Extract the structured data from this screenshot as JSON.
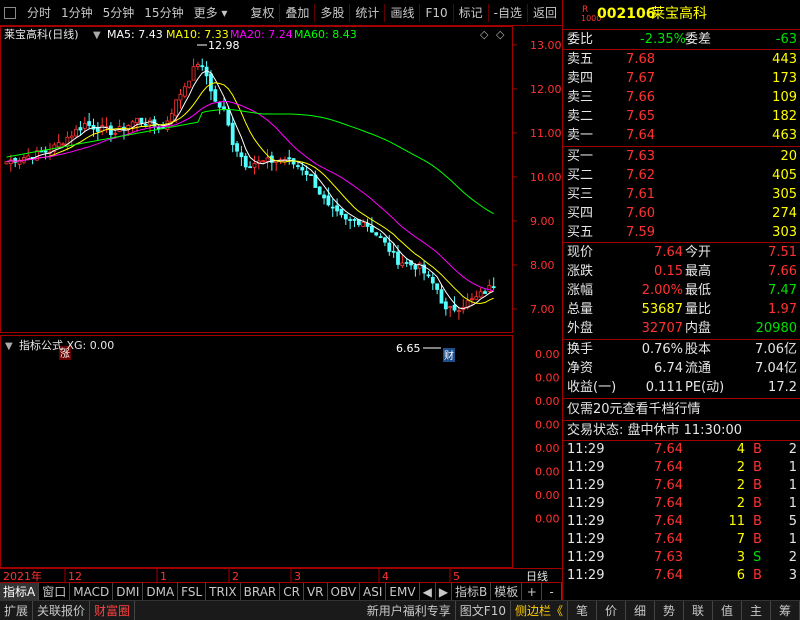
{
  "toolbar": {
    "items": [
      "分时",
      "1分钟",
      "5分钟",
      "15分钟",
      "更多",
      "复权",
      "叠加",
      "多股",
      "统计",
      "画线",
      "F10",
      "标记",
      "-自选",
      "返回"
    ]
  },
  "chart": {
    "header": {
      "title": "莱宝高科(日线)",
      "ma5": "MA5: 7.43",
      "ma10": "MA10: 7.33",
      "ma20": "MA20: 7.24",
      "ma60": "MA60: 8.43"
    },
    "high_label": "12.98",
    "low_label": "6.65",
    "zhang_badge": "涨",
    "cai_badge": "财",
    "indicator_header": "指标公式 XG: 0.00",
    "date_label_year": "2021年",
    "date_marks": [
      "12",
      "1",
      "2",
      "3",
      "4",
      "5"
    ],
    "period_label": "日线",
    "colors": {
      "up": "#ff3232",
      "down": "#54ffff",
      "ma5": "#ffffff",
      "ma10": "#ffff00",
      "ma20": "#ff00ff",
      "ma60": "#00ff00",
      "border": "#a00000"
    }
  },
  "chart_data": {
    "type": "candlestick",
    "y_ticks": [
      "13.00",
      "12.00",
      "11.00",
      "10.00",
      "9.00",
      "8.00",
      "7.00"
    ],
    "ylim": [
      6.5,
      13.2
    ],
    "indicator_ticks": [
      "0.00",
      "0.00",
      "0.00",
      "0.00",
      "0.00",
      "0.00",
      "0.00",
      "0.00"
    ],
    "x_labels": [
      "12",
      "1",
      "2",
      "3",
      "4",
      "5"
    ]
  },
  "quote": {
    "badge_top": "R",
    "badge_bottom": "1000",
    "code": "002106",
    "name": "莱宝高科",
    "weibi_label": "委比",
    "weibi_value": "-2.35%",
    "weicha_label": "委差",
    "weicha_value": "-63",
    "asks": [
      {
        "label": "卖五",
        "price": "7.68",
        "vol": "443"
      },
      {
        "label": "卖四",
        "price": "7.67",
        "vol": "173"
      },
      {
        "label": "卖三",
        "price": "7.66",
        "vol": "109"
      },
      {
        "label": "卖二",
        "price": "7.65",
        "vol": "182"
      },
      {
        "label": "卖一",
        "price": "7.64",
        "vol": "463"
      }
    ],
    "bids": [
      {
        "label": "买一",
        "price": "7.63",
        "vol": "20"
      },
      {
        "label": "买二",
        "price": "7.62",
        "vol": "405"
      },
      {
        "label": "买三",
        "price": "7.61",
        "vol": "305"
      },
      {
        "label": "买四",
        "price": "7.60",
        "vol": "274"
      },
      {
        "label": "买五",
        "price": "7.59",
        "vol": "303"
      }
    ],
    "stats": [
      {
        "l1": "现价",
        "v1": "7.64",
        "c1": "red",
        "l2": "今开",
        "v2": "7.51",
        "c2": "red"
      },
      {
        "l1": "涨跌",
        "v1": "0.15",
        "c1": "red",
        "l2": "最高",
        "v2": "7.66",
        "c2": "red"
      },
      {
        "l1": "涨幅",
        "v1": "2.00%",
        "c1": "red",
        "l2": "最低",
        "v2": "7.47",
        "c2": "green"
      },
      {
        "l1": "总量",
        "v1": "53687",
        "c1": "yellow",
        "l2": "量比",
        "v2": "1.97",
        "c2": "red"
      },
      {
        "l1": "外盘",
        "v1": "32707",
        "c1": "red",
        "l2": "内盘",
        "v2": "20980",
        "c2": "green"
      }
    ],
    "stats2": [
      {
        "l1": "换手",
        "v1": "0.76%",
        "l2": "股本",
        "v2": "7.06亿"
      },
      {
        "l1": "净资",
        "v1": "6.74",
        "l2": "流通",
        "v2": "7.04亿"
      },
      {
        "l1": "收益(一)",
        "v1": "0.111",
        "l2": "PE(动)",
        "v2": "17.2"
      }
    ],
    "promo": "仅需20元查看千档行情",
    "trade_status": "交易状态: 盘中休市 11:30:00",
    "ticks": [
      {
        "time": "11:29",
        "price": "7.64",
        "vol": "4",
        "bs": "B",
        "n": "2"
      },
      {
        "time": "11:29",
        "price": "7.64",
        "vol": "2",
        "bs": "B",
        "n": "1"
      },
      {
        "time": "11:29",
        "price": "7.64",
        "vol": "2",
        "bs": "B",
        "n": "1"
      },
      {
        "time": "11:29",
        "price": "7.64",
        "vol": "2",
        "bs": "B",
        "n": "1"
      },
      {
        "time": "11:29",
        "price": "7.64",
        "vol": "11",
        "bs": "B",
        "n": "5"
      },
      {
        "time": "11:29",
        "price": "7.64",
        "vol": "7",
        "bs": "B",
        "n": "1"
      },
      {
        "time": "11:29",
        "price": "7.63",
        "vol": "3",
        "bs": "S",
        "n": "2"
      },
      {
        "time": "11:29",
        "price": "7.64",
        "vol": "6",
        "bs": "B",
        "n": "3"
      }
    ]
  },
  "tabs": {
    "items": [
      "指标A",
      "窗口",
      "MACD",
      "DMI",
      "DMA",
      "FSL",
      "TRIX",
      "BRAR",
      "CR",
      "VR",
      "OBV",
      "ASI",
      "EMV",
      "◀",
      "▶"
    ],
    "right": [
      "指标B",
      "模板",
      "+",
      "-"
    ]
  },
  "status": {
    "left": [
      "扩展",
      "关联报价",
      "财富圈"
    ],
    "middle": [
      "新用户福利专享",
      "图文F10",
      "侧边栏《"
    ],
    "right": [
      "笔",
      "价",
      "细",
      "势",
      "联",
      "值",
      "主",
      "筹"
    ]
  }
}
